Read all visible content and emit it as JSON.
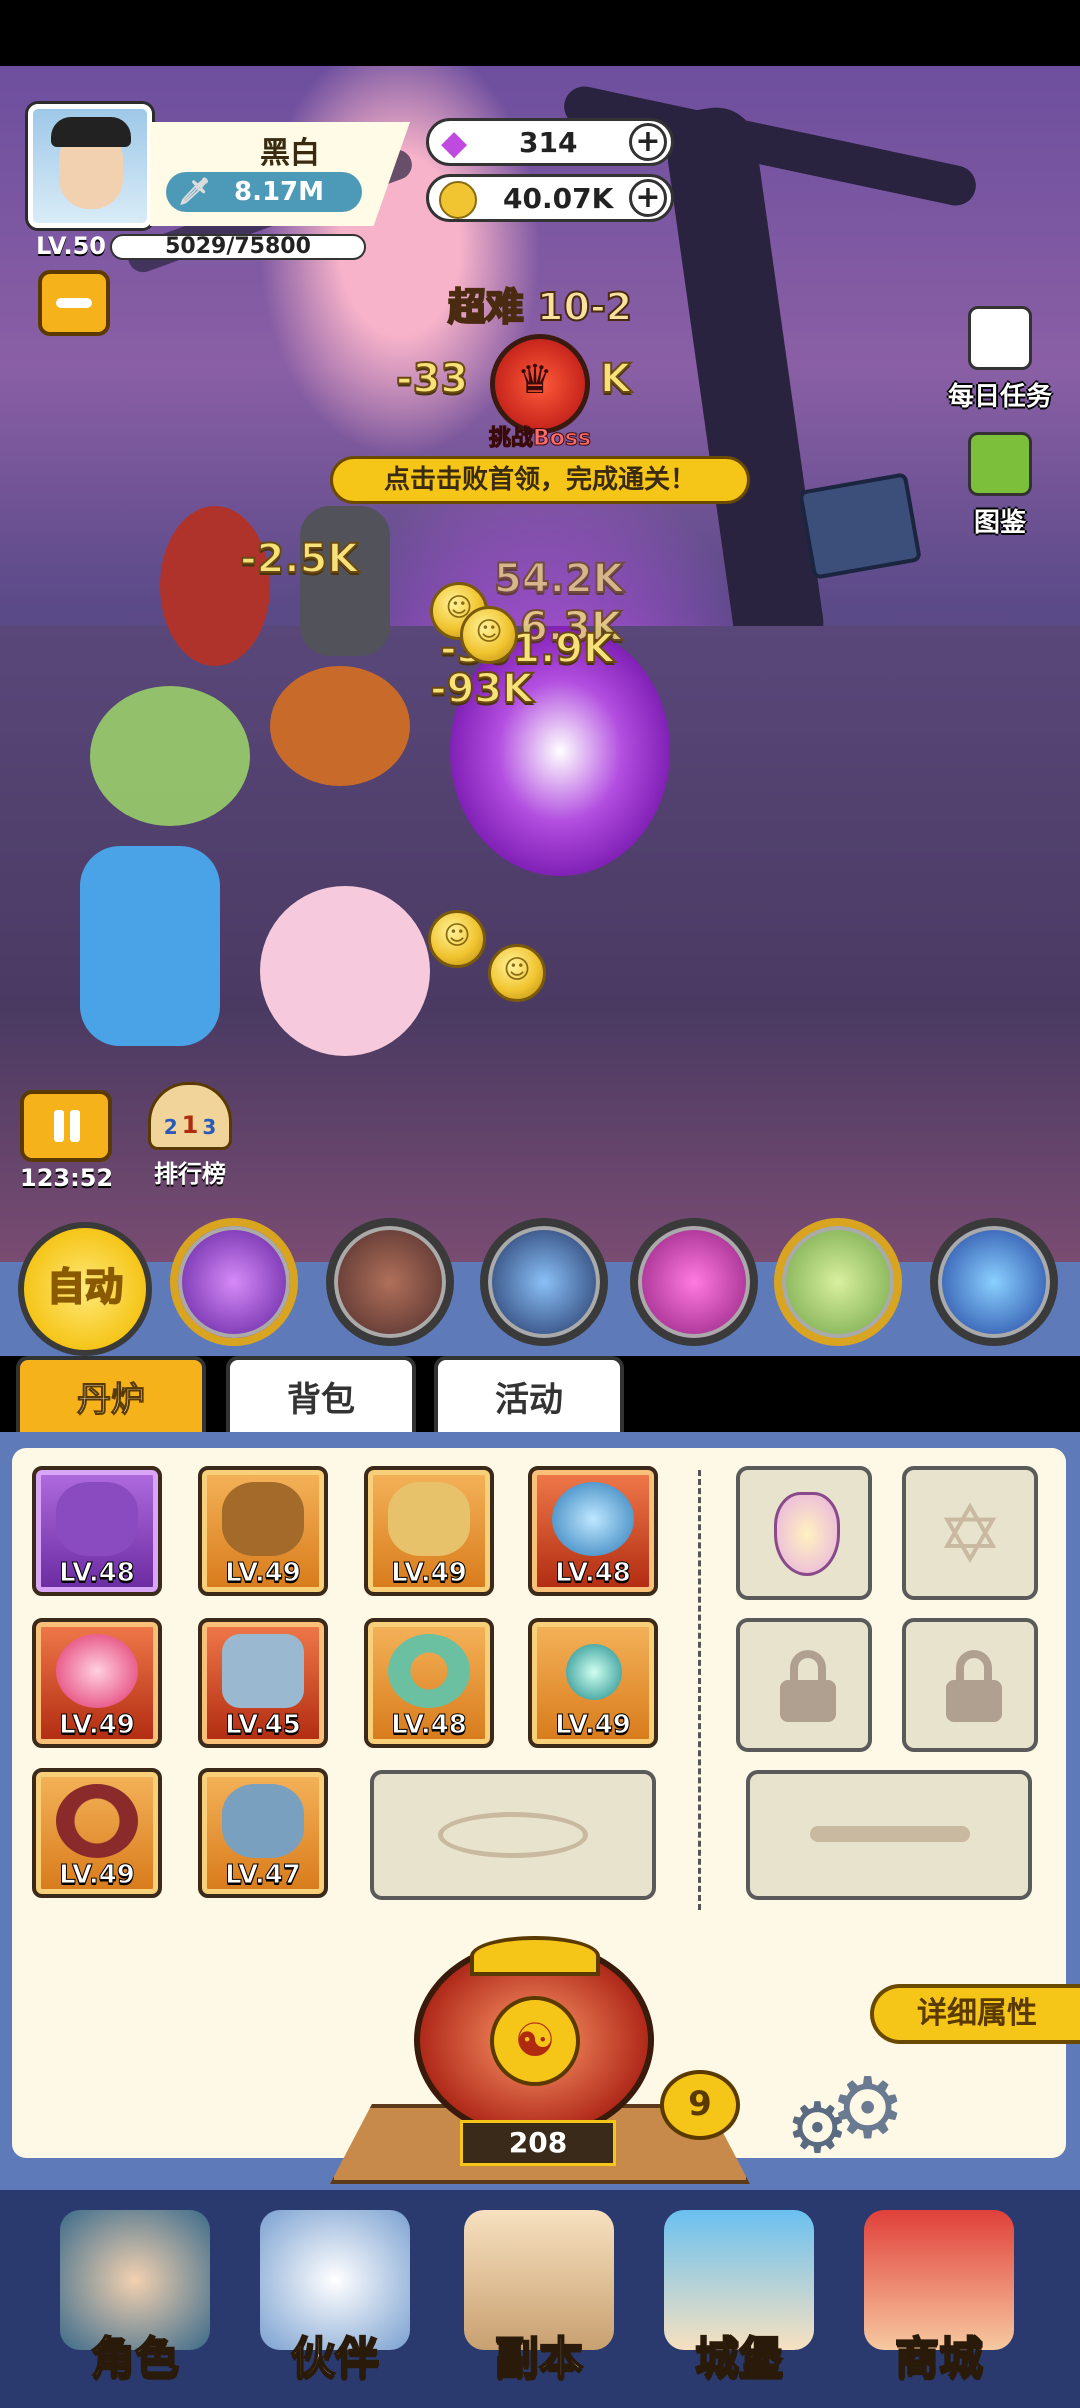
{
  "player": {
    "name": "黑白",
    "power": "8.17M",
    "level": "LV.50",
    "exp": "5029/75800"
  },
  "resources": {
    "gems": "314",
    "coins": "40.07K"
  },
  "stage": {
    "title": "超难 10-2",
    "boss_label": "挑战Boss",
    "hint": "点击击败首领，完成通关！"
  },
  "damage_numbers": [
    "-33",
    "K",
    "-2.5K",
    "54.2K",
    "6.3K",
    "-301.9K",
    "-93K"
  ],
  "side_menu": {
    "daily_tasks": "每日任务",
    "codex": "图鉴"
  },
  "controls": {
    "timer": "123:52",
    "ranking": "排行榜",
    "auto": "自动",
    "rank_digits": [
      "2",
      "1",
      "3"
    ]
  },
  "tabs": [
    "丹炉",
    "背包",
    "活动"
  ],
  "equipment": [
    {
      "level": "LV.48",
      "icon": "spear-icon",
      "rarity": "purple"
    },
    {
      "level": "LV.49",
      "icon": "helmet-icon",
      "rarity": "orange"
    },
    {
      "level": "LV.49",
      "icon": "armor-icon",
      "rarity": "orange"
    },
    {
      "level": "LV.48",
      "icon": "orb-icon",
      "rarity": "red"
    },
    {
      "level": "LV.49",
      "icon": "potion-icon",
      "rarity": "red"
    },
    {
      "level": "LV.45",
      "icon": "bagua-icon",
      "rarity": "red"
    },
    {
      "level": "LV.48",
      "icon": "ring-icon",
      "rarity": "orange"
    },
    {
      "level": "LV.49",
      "icon": "pearl-icon",
      "rarity": "orange"
    },
    {
      "level": "LV.49",
      "icon": "belt-icon",
      "rarity": "orange"
    },
    {
      "level": "LV.47",
      "icon": "boots-icon",
      "rarity": "orange"
    }
  ],
  "furnace": {
    "value": "208",
    "badge": "9",
    "details": "详细属性"
  },
  "nav": [
    "角色",
    "伙伴",
    "副本",
    "城堡",
    "商城"
  ],
  "colors": {
    "accent": "#f5c518",
    "panel": "#5f7ab8",
    "nav": "#2b3a6e"
  }
}
